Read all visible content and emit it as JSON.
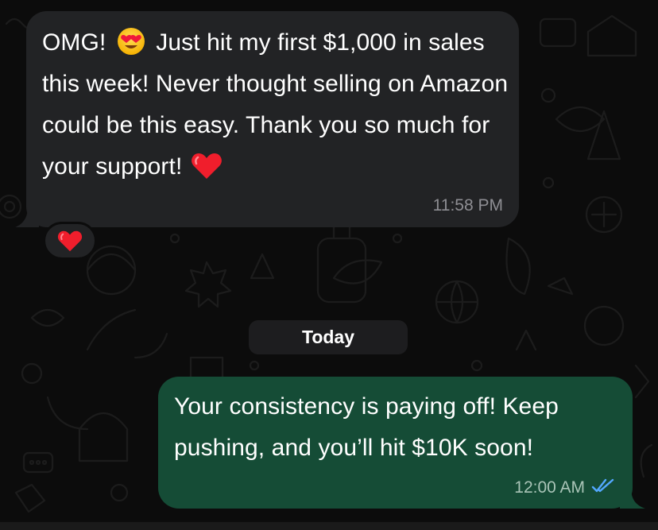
{
  "conversation": {
    "incoming": {
      "text_before_emoji": "OMG! ",
      "emoji_1": "smiling-face-heart-eyes-icon",
      "text_after_emoji": " Just hit my first $1,000 in sales this week! Never thought selling on Amazon could be this easy. Thank you so much for your support! ",
      "emoji_2": "red-heart-icon",
      "time": "11:58 PM",
      "reaction": "red-heart-icon"
    },
    "date_separator": "Today",
    "outgoing": {
      "text": "Your consistency is paying off! Keep pushing, and you’ll hit $10K soon!",
      "time": "12:00 AM",
      "status": "read-double-check-icon"
    }
  },
  "colors": {
    "background": "#0c0c0c",
    "incoming_bubble": "#222325",
    "outgoing_bubble": "#154c36",
    "read_tick": "#53a8ff",
    "timestamp": "#8e8e93"
  }
}
